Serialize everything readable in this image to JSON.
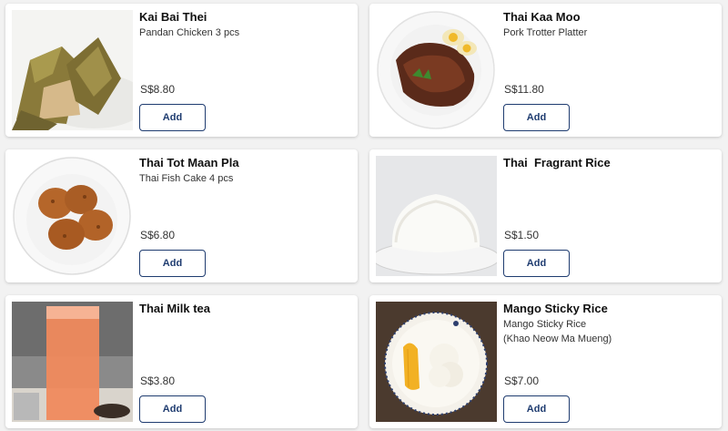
{
  "colors": {
    "accent": "#1f3c70",
    "card_bg": "#ffffff",
    "page_bg": "#f2f2f2"
  },
  "items": [
    {
      "name": "Kai Bai Thei",
      "description": "Pandan Chicken 3 pcs",
      "price": "S$8.80",
      "button": "Add",
      "image": "pandan-chicken-image"
    },
    {
      "name": "Thai Kaa Moo",
      "description": "Pork Trotter Platter",
      "price": "S$11.80",
      "button": "Add",
      "image": "pork-trotter-image"
    },
    {
      "name": "Thai Tot Maan Pla",
      "description": "Thai Fish Cake 4 pcs",
      "price": "S$6.80",
      "button": "Add",
      "image": "fish-cake-image"
    },
    {
      "name": "Thai  Fragrant Rice",
      "description": "",
      "price": "S$1.50",
      "button": "Add",
      "image": "fragrant-rice-image"
    },
    {
      "name": "Thai Milk tea",
      "description": "",
      "price": "S$3.80",
      "button": "Add",
      "image": "milk-tea-image"
    },
    {
      "name": "Mango Sticky Rice",
      "description": "Mango Sticky Rice\n(Khao Neow Ma Mueng)",
      "price": "S$7.00",
      "button": "Add",
      "image": "mango-sticky-rice-image"
    }
  ]
}
